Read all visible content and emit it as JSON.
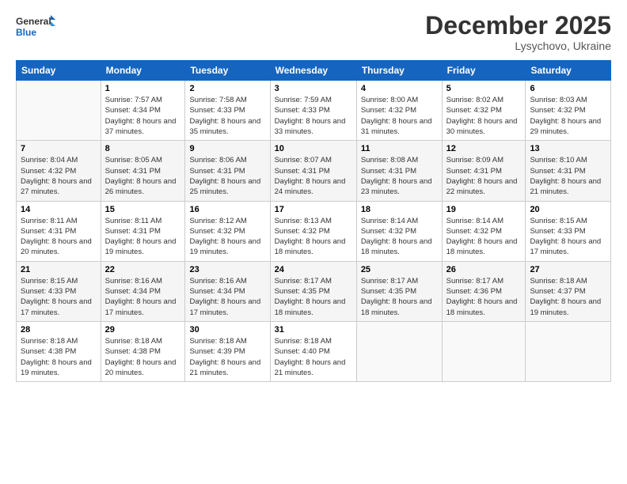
{
  "header": {
    "logo_line1": "General",
    "logo_line2": "Blue",
    "month": "December 2025",
    "location": "Lysychovo, Ukraine"
  },
  "days_of_week": [
    "Sunday",
    "Monday",
    "Tuesday",
    "Wednesday",
    "Thursday",
    "Friday",
    "Saturday"
  ],
  "weeks": [
    [
      {
        "day": "",
        "sunrise": "",
        "sunset": "",
        "daylight": ""
      },
      {
        "day": "1",
        "sunrise": "Sunrise: 7:57 AM",
        "sunset": "Sunset: 4:34 PM",
        "daylight": "Daylight: 8 hours and 37 minutes."
      },
      {
        "day": "2",
        "sunrise": "Sunrise: 7:58 AM",
        "sunset": "Sunset: 4:33 PM",
        "daylight": "Daylight: 8 hours and 35 minutes."
      },
      {
        "day": "3",
        "sunrise": "Sunrise: 7:59 AM",
        "sunset": "Sunset: 4:33 PM",
        "daylight": "Daylight: 8 hours and 33 minutes."
      },
      {
        "day": "4",
        "sunrise": "Sunrise: 8:00 AM",
        "sunset": "Sunset: 4:32 PM",
        "daylight": "Daylight: 8 hours and 31 minutes."
      },
      {
        "day": "5",
        "sunrise": "Sunrise: 8:02 AM",
        "sunset": "Sunset: 4:32 PM",
        "daylight": "Daylight: 8 hours and 30 minutes."
      },
      {
        "day": "6",
        "sunrise": "Sunrise: 8:03 AM",
        "sunset": "Sunset: 4:32 PM",
        "daylight": "Daylight: 8 hours and 29 minutes."
      }
    ],
    [
      {
        "day": "7",
        "sunrise": "Sunrise: 8:04 AM",
        "sunset": "Sunset: 4:32 PM",
        "daylight": "Daylight: 8 hours and 27 minutes."
      },
      {
        "day": "8",
        "sunrise": "Sunrise: 8:05 AM",
        "sunset": "Sunset: 4:31 PM",
        "daylight": "Daylight: 8 hours and 26 minutes."
      },
      {
        "day": "9",
        "sunrise": "Sunrise: 8:06 AM",
        "sunset": "Sunset: 4:31 PM",
        "daylight": "Daylight: 8 hours and 25 minutes."
      },
      {
        "day": "10",
        "sunrise": "Sunrise: 8:07 AM",
        "sunset": "Sunset: 4:31 PM",
        "daylight": "Daylight: 8 hours and 24 minutes."
      },
      {
        "day": "11",
        "sunrise": "Sunrise: 8:08 AM",
        "sunset": "Sunset: 4:31 PM",
        "daylight": "Daylight: 8 hours and 23 minutes."
      },
      {
        "day": "12",
        "sunrise": "Sunrise: 8:09 AM",
        "sunset": "Sunset: 4:31 PM",
        "daylight": "Daylight: 8 hours and 22 minutes."
      },
      {
        "day": "13",
        "sunrise": "Sunrise: 8:10 AM",
        "sunset": "Sunset: 4:31 PM",
        "daylight": "Daylight: 8 hours and 21 minutes."
      }
    ],
    [
      {
        "day": "14",
        "sunrise": "Sunrise: 8:11 AM",
        "sunset": "Sunset: 4:31 PM",
        "daylight": "Daylight: 8 hours and 20 minutes."
      },
      {
        "day": "15",
        "sunrise": "Sunrise: 8:11 AM",
        "sunset": "Sunset: 4:31 PM",
        "daylight": "Daylight: 8 hours and 19 minutes."
      },
      {
        "day": "16",
        "sunrise": "Sunrise: 8:12 AM",
        "sunset": "Sunset: 4:32 PM",
        "daylight": "Daylight: 8 hours and 19 minutes."
      },
      {
        "day": "17",
        "sunrise": "Sunrise: 8:13 AM",
        "sunset": "Sunset: 4:32 PM",
        "daylight": "Daylight: 8 hours and 18 minutes."
      },
      {
        "day": "18",
        "sunrise": "Sunrise: 8:14 AM",
        "sunset": "Sunset: 4:32 PM",
        "daylight": "Daylight: 8 hours and 18 minutes."
      },
      {
        "day": "19",
        "sunrise": "Sunrise: 8:14 AM",
        "sunset": "Sunset: 4:32 PM",
        "daylight": "Daylight: 8 hours and 18 minutes."
      },
      {
        "day": "20",
        "sunrise": "Sunrise: 8:15 AM",
        "sunset": "Sunset: 4:33 PM",
        "daylight": "Daylight: 8 hours and 17 minutes."
      }
    ],
    [
      {
        "day": "21",
        "sunrise": "Sunrise: 8:15 AM",
        "sunset": "Sunset: 4:33 PM",
        "daylight": "Daylight: 8 hours and 17 minutes."
      },
      {
        "day": "22",
        "sunrise": "Sunrise: 8:16 AM",
        "sunset": "Sunset: 4:34 PM",
        "daylight": "Daylight: 8 hours and 17 minutes."
      },
      {
        "day": "23",
        "sunrise": "Sunrise: 8:16 AM",
        "sunset": "Sunset: 4:34 PM",
        "daylight": "Daylight: 8 hours and 17 minutes."
      },
      {
        "day": "24",
        "sunrise": "Sunrise: 8:17 AM",
        "sunset": "Sunset: 4:35 PM",
        "daylight": "Daylight: 8 hours and 18 minutes."
      },
      {
        "day": "25",
        "sunrise": "Sunrise: 8:17 AM",
        "sunset": "Sunset: 4:35 PM",
        "daylight": "Daylight: 8 hours and 18 minutes."
      },
      {
        "day": "26",
        "sunrise": "Sunrise: 8:17 AM",
        "sunset": "Sunset: 4:36 PM",
        "daylight": "Daylight: 8 hours and 18 minutes."
      },
      {
        "day": "27",
        "sunrise": "Sunrise: 8:18 AM",
        "sunset": "Sunset: 4:37 PM",
        "daylight": "Daylight: 8 hours and 19 minutes."
      }
    ],
    [
      {
        "day": "28",
        "sunrise": "Sunrise: 8:18 AM",
        "sunset": "Sunset: 4:38 PM",
        "daylight": "Daylight: 8 hours and 19 minutes."
      },
      {
        "day": "29",
        "sunrise": "Sunrise: 8:18 AM",
        "sunset": "Sunset: 4:38 PM",
        "daylight": "Daylight: 8 hours and 20 minutes."
      },
      {
        "day": "30",
        "sunrise": "Sunrise: 8:18 AM",
        "sunset": "Sunset: 4:39 PM",
        "daylight": "Daylight: 8 hours and 21 minutes."
      },
      {
        "day": "31",
        "sunrise": "Sunrise: 8:18 AM",
        "sunset": "Sunset: 4:40 PM",
        "daylight": "Daylight: 8 hours and 21 minutes."
      },
      {
        "day": "",
        "sunrise": "",
        "sunset": "",
        "daylight": ""
      },
      {
        "day": "",
        "sunrise": "",
        "sunset": "",
        "daylight": ""
      },
      {
        "day": "",
        "sunrise": "",
        "sunset": "",
        "daylight": ""
      }
    ]
  ]
}
